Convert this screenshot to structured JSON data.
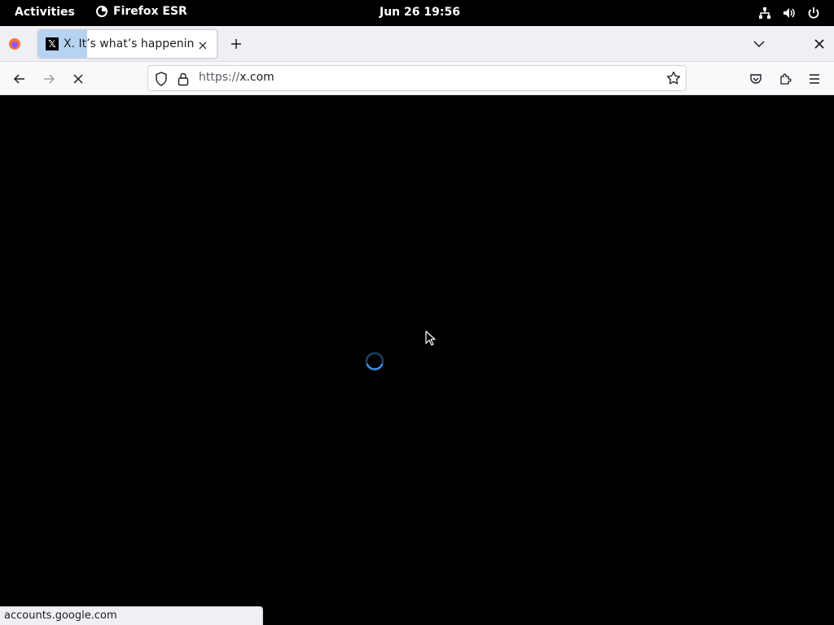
{
  "topbar": {
    "activities": "Activities",
    "app_name": "Firefox ESR",
    "clock": "Jun 26  19:56",
    "icons": [
      "network-icon",
      "volume-icon",
      "power-icon"
    ]
  },
  "tabs": [
    {
      "title": "X. It’s what’s happening / X",
      "favicon": "x-logo-icon",
      "active": true
    }
  ],
  "navbar": {
    "url_scheme": "https://",
    "url_host": "x.com"
  },
  "status": {
    "text": "accounts.google.com"
  },
  "colors": {
    "page_bg": "#000000",
    "chrome_bg": "#f0f0f4",
    "tab_highlight": "#b7d3f3",
    "spinner": "#3b8ee8"
  }
}
